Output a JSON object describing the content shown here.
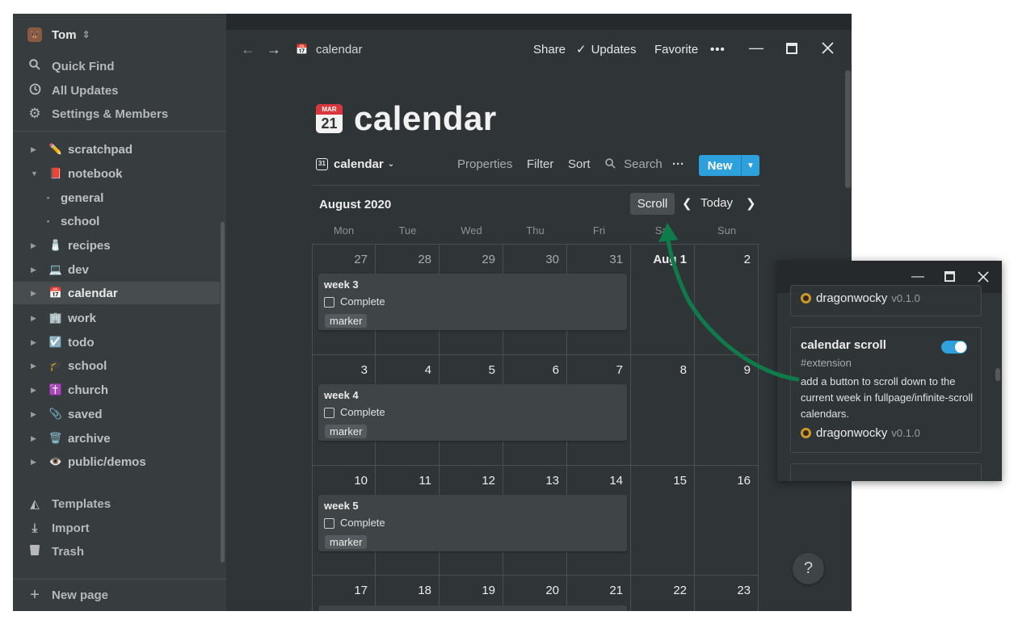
{
  "sidebar": {
    "workspace": "Tom",
    "nav": [
      {
        "label": "Quick Find",
        "icon": "search-icon"
      },
      {
        "label": "All Updates",
        "icon": "clock-icon"
      },
      {
        "label": "Settings & Members",
        "icon": "gear-icon"
      }
    ],
    "tree": [
      {
        "label": "scratchpad",
        "emoji": "✏️"
      },
      {
        "label": "notebook",
        "emoji": "📕",
        "expanded": true
      },
      {
        "label": "general",
        "sub": true
      },
      {
        "label": "school",
        "sub": true
      },
      {
        "label": "recipes",
        "emoji": "🧂"
      },
      {
        "label": "dev",
        "emoji": "💻"
      },
      {
        "label": "calendar",
        "emoji": "📅",
        "active": true
      },
      {
        "label": "work",
        "emoji": "🏢"
      },
      {
        "label": "todo",
        "emoji": "☑️"
      },
      {
        "label": "school",
        "emoji": "🎓"
      },
      {
        "label": "church",
        "emoji": "✝️"
      },
      {
        "label": "saved",
        "emoji": "📎"
      },
      {
        "label": "archive",
        "emoji": "🗑️"
      },
      {
        "label": "public/demos",
        "emoji": "👁️"
      }
    ],
    "bottom": [
      {
        "label": "Templates",
        "icon": "templates-icon"
      },
      {
        "label": "Import",
        "icon": "import-icon"
      },
      {
        "label": "Trash",
        "icon": "trash-icon"
      }
    ],
    "new_page": "New page"
  },
  "topbar": {
    "breadcrumb": "calendar",
    "share": "Share",
    "updates": "Updates",
    "favorite": "Favorite",
    "more": "•••"
  },
  "page": {
    "title": "calendar",
    "icon_month": "MAR",
    "icon_day": "21"
  },
  "view": {
    "name": "calendar",
    "properties": "Properties",
    "filter": "Filter",
    "sort": "Sort",
    "search": "Search",
    "more": "···",
    "new": "New"
  },
  "calendar": {
    "month": "August 2020",
    "scroll": "Scroll",
    "today": "Today",
    "weekdays": [
      "Mon",
      "Tue",
      "Wed",
      "Thu",
      "Fri",
      "Sat",
      "Sun"
    ],
    "weeks": [
      [
        "27",
        "28",
        "29",
        "30",
        "31",
        "Aug 1",
        "2"
      ],
      [
        "3",
        "4",
        "5",
        "6",
        "7",
        "8",
        "9"
      ],
      [
        "10",
        "11",
        "12",
        "13",
        "14",
        "15",
        "16"
      ],
      [
        "17",
        "18",
        "19",
        "20",
        "21",
        "22",
        "23"
      ]
    ],
    "cards": [
      {
        "title": "week 3",
        "checkbox": "Complete",
        "tag": "marker"
      },
      {
        "title": "week 4",
        "checkbox": "Complete",
        "tag": "marker"
      },
      {
        "title": "week 5",
        "checkbox": "Complete",
        "tag": "marker"
      }
    ]
  },
  "help": "?",
  "popup": {
    "prev_author": "dragonwocky",
    "prev_version": "v0.1.0",
    "ext_title": "calendar scroll",
    "ext_tag": "#extension",
    "ext_desc": "add a button to scroll down to the current week in fullpage/infinite-scroll calendars.",
    "ext_author": "dragonwocky",
    "ext_version": "v0.1.0",
    "toggle_on": true
  },
  "colors": {
    "accent": "#2ea0dc",
    "arrow": "#0f7a4a"
  }
}
